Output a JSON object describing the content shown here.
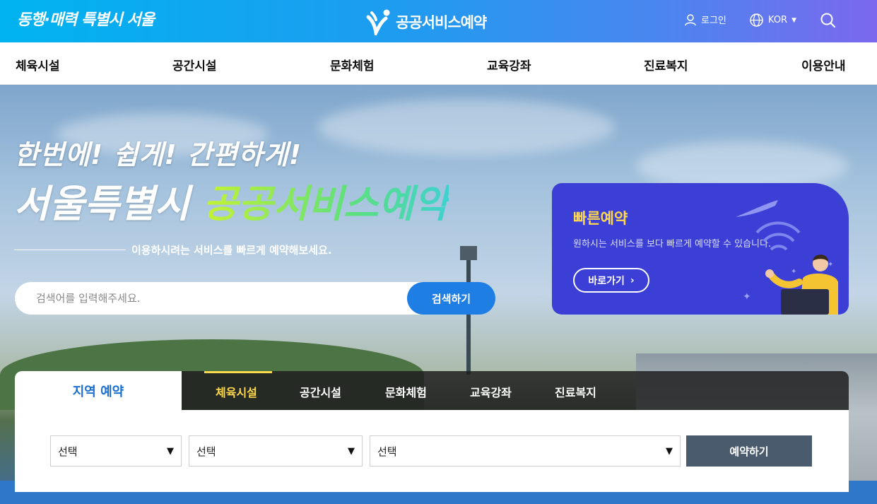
{
  "header": {
    "slogan": "동행·매력 특별시 서울",
    "brand_name": "공공서비스예약",
    "login_label": "로그인",
    "lang_label": "KOR"
  },
  "gnb": {
    "items": [
      "체육시설",
      "공간시설",
      "문화체험",
      "교육강좌",
      "진료복지",
      "이용안내"
    ]
  },
  "hero": {
    "line1": "한번에! 쉽게! 간편하게!",
    "line2_prefix": "서울특별시 ",
    "line2_highlight": "공공서비스예약",
    "subtitle": "이용하시려는 서비스를 빠르게 예약해보세요.",
    "search_placeholder": "검색어를 입력해주세요.",
    "search_button": "검색하기"
  },
  "quick": {
    "title": "빠른예약",
    "description": "원하시는 서비스를 보다 빠르게 예약할 수 있습니다.",
    "button": "바로가기"
  },
  "region": {
    "tab_label": "지역 예약",
    "categories": [
      "체육시설",
      "공간시설",
      "문화체험",
      "교육강좌",
      "진료복지"
    ],
    "active_category": "체육시설",
    "selects": [
      "선택",
      "선택",
      "선택"
    ],
    "book_button": "예약하기"
  },
  "colors": {
    "header_gradient_start": "#00b3f0",
    "header_gradient_end": "#7b68ee",
    "primary_blue": "#1f7ee3",
    "quick_card": "#3b3fd6",
    "highlight_yellow": "#ffd84c",
    "book_button": "#4a5b6d"
  }
}
